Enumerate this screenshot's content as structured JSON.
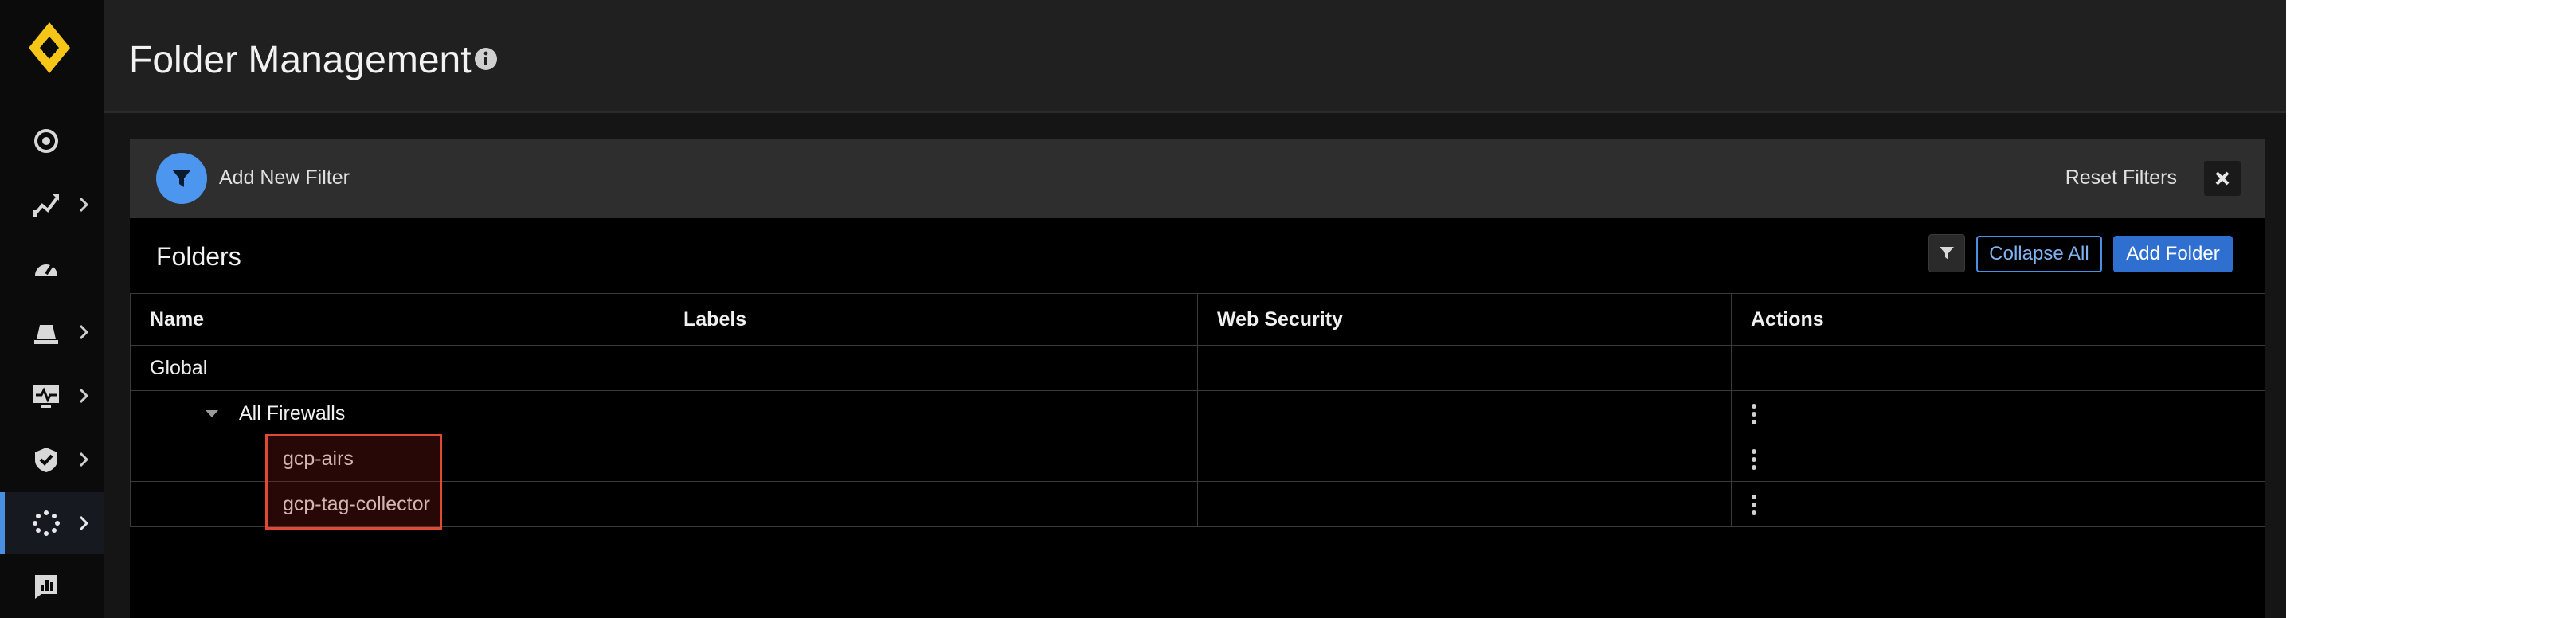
{
  "app": {
    "page_title": "Folder Management",
    "accent_color": "#4a90e2",
    "brand_color": "#f5c518",
    "highlight_color": "#e04a35"
  },
  "sidebar": {
    "logo": "prisma-logo",
    "items": [
      {
        "icon": "target-icon",
        "has_chevron": false,
        "active": false
      },
      {
        "icon": "activity-icon",
        "has_chevron": true,
        "active": false
      },
      {
        "icon": "dashboard-icon",
        "has_chevron": false,
        "active": false
      },
      {
        "icon": "alarm-icon",
        "has_chevron": true,
        "active": false
      },
      {
        "icon": "monitor-icon",
        "has_chevron": true,
        "active": false
      },
      {
        "icon": "shield-icon",
        "has_chevron": true,
        "active": false
      },
      {
        "icon": "settings-icon",
        "has_chevron": true,
        "active": true
      },
      {
        "icon": "reports-icon",
        "has_chevron": false,
        "active": false
      }
    ]
  },
  "filter_bar": {
    "add_filter_label": "Add New Filter",
    "reset_label": "Reset Filters"
  },
  "folders": {
    "title": "Folders",
    "collapse_label": "Collapse All",
    "add_label": "Add Folder",
    "columns": [
      "Name",
      "Labels",
      "Web Security",
      "Actions"
    ],
    "rows": [
      {
        "name": "Global",
        "level": 0,
        "expandable": false,
        "has_actions": false
      },
      {
        "name": "All Firewalls",
        "level": 1,
        "expandable": true,
        "has_actions": true
      },
      {
        "name": "gcp-airs",
        "level": 2,
        "expandable": false,
        "has_actions": true
      },
      {
        "name": "gcp-tag-collector",
        "level": 2,
        "expandable": false,
        "has_actions": true
      }
    ]
  }
}
